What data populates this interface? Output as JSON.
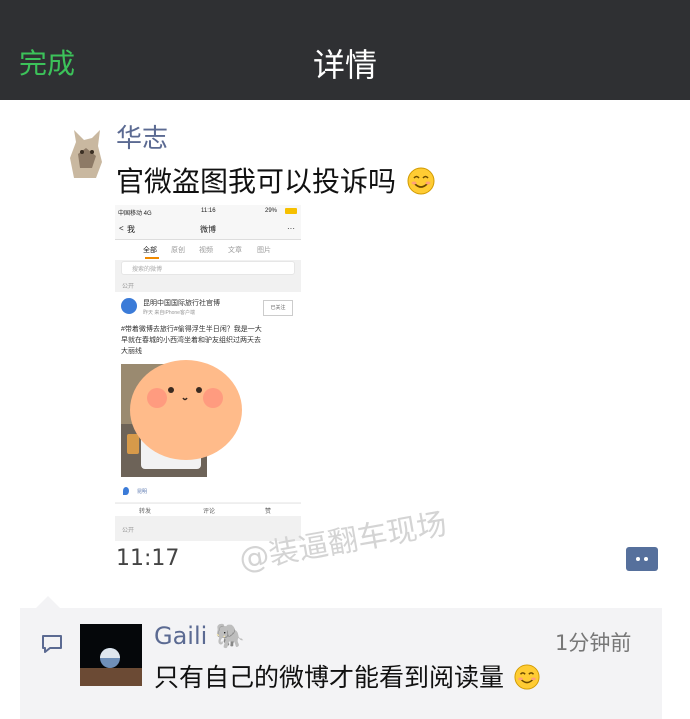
{
  "nav": {
    "done_label": "完成",
    "title": "详情"
  },
  "post": {
    "author": "华志",
    "text": "官微盗图我可以投诉吗",
    "time": "11:17",
    "screenshot": {
      "carrier": "中国移动 4G",
      "clock": "11:16",
      "battery": "29%",
      "back_label": "我",
      "header_title": "微博",
      "more": "···",
      "tabs": [
        "全部",
        "原创",
        "视频",
        "文章",
        "图片"
      ],
      "search_placeholder": "搜索的微博",
      "visibility_top": "公开",
      "account_name": "昆明中国国际旅行社官博",
      "account_meta": "昨天 来自iPhone客户端",
      "follow_label": "已关注",
      "body_line1": "#带着微博去旅行#偷得浮生半日闲？我是一大",
      "body_line2": "早就在春城的小西湾坐着和驴友组织过两天去",
      "body_line3": "大丽线",
      "location": "昆明",
      "repost": "转发",
      "comment": "评论",
      "like": "赞",
      "visibility_bottom": "公开"
    }
  },
  "watermark": "@装逼翻车现场",
  "comment": {
    "name": "Gaili",
    "name_emoji": "🐘",
    "time": "1分钟前",
    "text": "只有自己的微博才能看到阅读量"
  },
  "colors": {
    "accent_green": "#3cc25a",
    "link_blue": "#5b6a92",
    "nav_bg": "#2f3033"
  }
}
